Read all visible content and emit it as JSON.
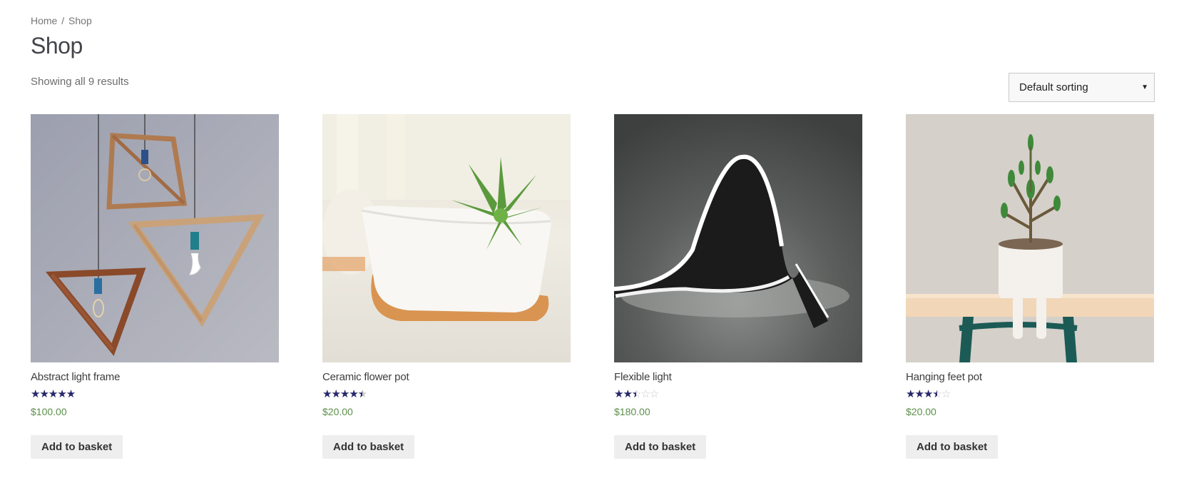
{
  "breadcrumb": {
    "home": "Home",
    "separator": "/",
    "current": "Shop"
  },
  "page_title": "Shop",
  "result_count": "Showing all 9 results",
  "ordering": {
    "selected": "Default sorting"
  },
  "colors": {
    "star": "#27286b",
    "price": "#5b8f4b",
    "button_bg": "#eeeeee"
  },
  "products": [
    {
      "title": "Abstract light frame",
      "rating": 5.0,
      "price": "$100.00",
      "button": "Add to basket"
    },
    {
      "title": "Ceramic flower pot",
      "rating": 4.5,
      "price": "$20.00",
      "button": "Add to basket"
    },
    {
      "title": "Flexible light",
      "rating": 2.5,
      "price": "$180.00",
      "button": "Add to basket"
    },
    {
      "title": "Hanging feet pot",
      "rating": 3.5,
      "price": "$20.00",
      "button": "Add to basket"
    }
  ]
}
